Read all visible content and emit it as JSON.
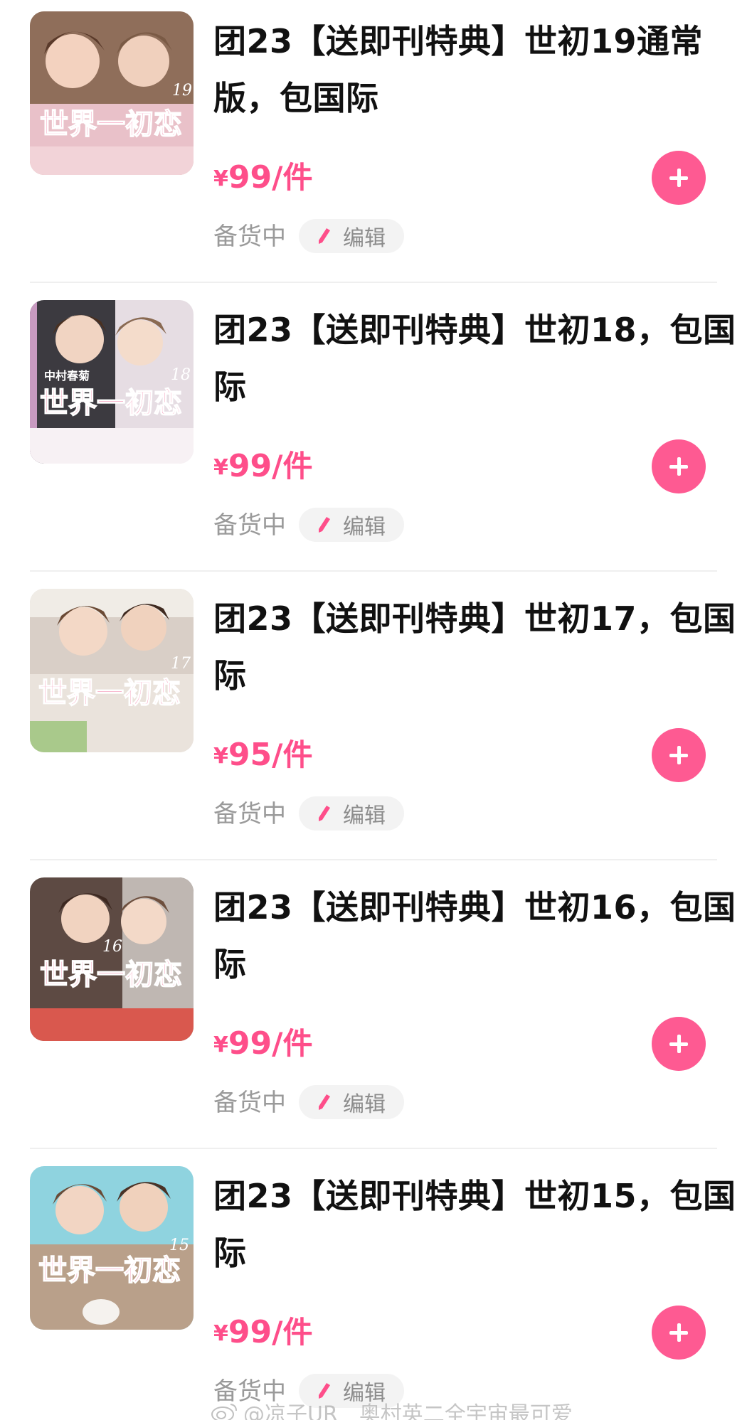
{
  "items": [
    {
      "title": "团23【送即刊特典】世初19通常版，包国际",
      "currency": "¥",
      "price": "99",
      "unit": "/件",
      "status": "备货中",
      "edit_label": "编辑",
      "cover": {
        "logo_text": "世界一初恋",
        "volume": "19",
        "accent": "#e8b8c8",
        "bg": "#c9a58a"
      }
    },
    {
      "title": "团23【送即刊特典】世初18，包国际",
      "currency": "¥",
      "price": "99",
      "unit": "/件",
      "status": "备货中",
      "edit_label": "编辑",
      "cover": {
        "logo_text": "世界一初恋",
        "volume": "18",
        "accent": "#d6a6c9",
        "bg": "#3c3a40"
      }
    },
    {
      "title": "团23【送即刊特典】世初17，包国际",
      "currency": "¥",
      "price": "95",
      "unit": "/件",
      "status": "备货中",
      "edit_label": "编辑",
      "cover": {
        "logo_text": "世界一初恋",
        "volume": "17",
        "accent": "#a9c98b",
        "bg": "#d9cfc7"
      }
    },
    {
      "title": "团23【送即刊特典】世初16，包国际",
      "currency": "¥",
      "price": "99",
      "unit": "/件",
      "status": "备货中",
      "edit_label": "编辑",
      "cover": {
        "logo_text": "世界一初恋",
        "volume": "16",
        "accent": "#d9584e",
        "bg": "#5d4a43"
      }
    },
    {
      "title": "团23【送即刊特典】世初15，包国际",
      "currency": "¥",
      "price": "99",
      "unit": "/件",
      "status": "备货中",
      "edit_label": "编辑",
      "cover": {
        "logo_text": "世界一初恋",
        "volume": "15",
        "accent": "#8fd3df",
        "bg": "#b9a08a"
      }
    }
  ],
  "watermark": "@凉子UR__奥村英二全宇宙最可爱",
  "colors": {
    "price": "#fe4e8a",
    "add_button": "#fe5a92",
    "status": "#9a9a9a",
    "title": "#111111"
  },
  "icons": {
    "add": "plus-icon",
    "edit": "pencil-icon",
    "watermark": "weibo-icon"
  }
}
